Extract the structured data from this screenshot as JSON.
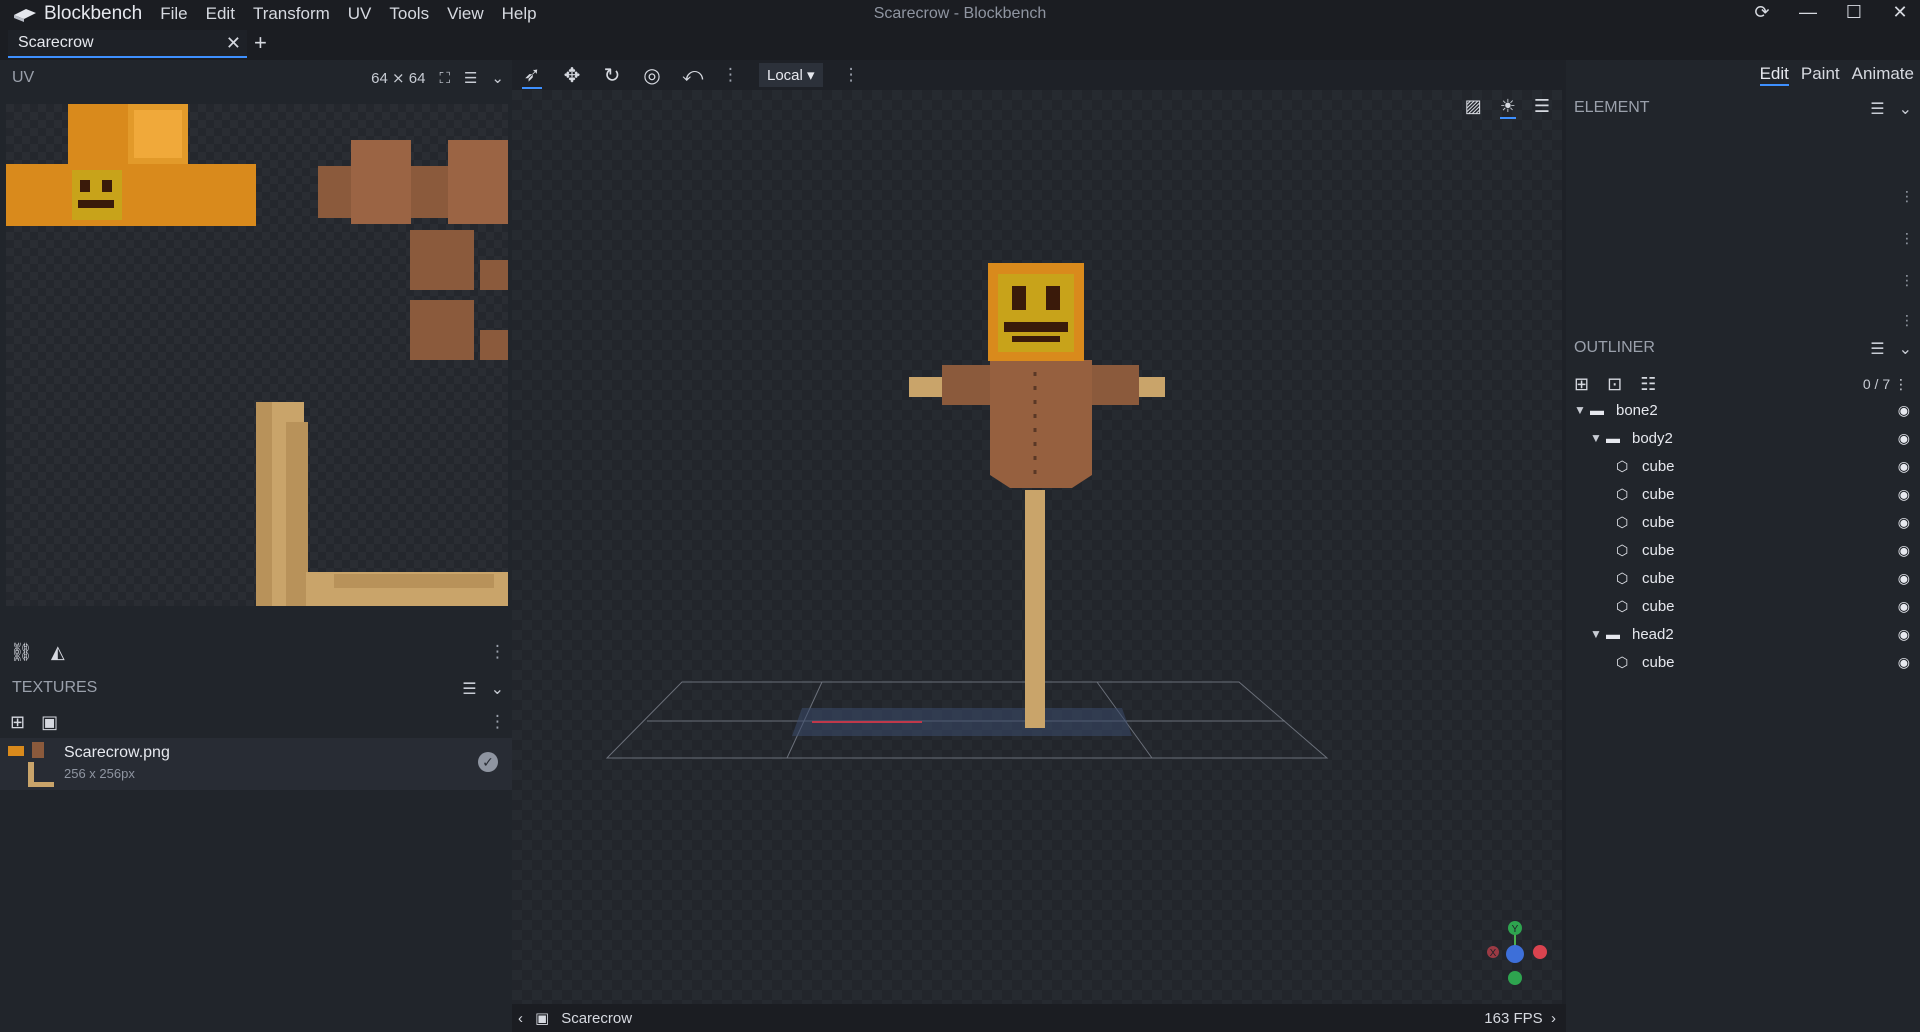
{
  "app": {
    "name": "Blockbench",
    "window_title": "Scarecrow - Blockbench",
    "menu": [
      "File",
      "Edit",
      "Transform",
      "UV",
      "Tools",
      "View",
      "Help"
    ]
  },
  "tabs": [
    {
      "label": "Scarecrow"
    }
  ],
  "left_panel": {
    "uv": {
      "title": "UV",
      "resolution": "64 ⨯ 64"
    },
    "textures": {
      "title": "TEXTURES",
      "items": [
        {
          "name": "Scarecrow.png",
          "size": "256 x 256px"
        }
      ]
    }
  },
  "toolbar": {
    "transform_space": "Local"
  },
  "viewport": {
    "status_name": "Scarecrow",
    "fps": "163 FPS"
  },
  "right_panel": {
    "modes": [
      "Edit",
      "Paint",
      "Animate"
    ],
    "active_mode": "Edit",
    "element_title": "ELEMENT",
    "outliner_title": "OUTLINER",
    "outliner_count": "0 / 7",
    "tree": [
      {
        "name": "bone2",
        "type": "group"
      },
      {
        "name": "body2",
        "type": "group"
      },
      {
        "name": "cube",
        "type": "cube"
      },
      {
        "name": "cube",
        "type": "cube"
      },
      {
        "name": "cube",
        "type": "cube"
      },
      {
        "name": "cube",
        "type": "cube"
      },
      {
        "name": "cube",
        "type": "cube"
      },
      {
        "name": "cube",
        "type": "cube"
      },
      {
        "name": "head2",
        "type": "group"
      },
      {
        "name": "cube",
        "type": "cube"
      }
    ]
  },
  "colors": {
    "accent": "#3e90ff",
    "panel": "#21252b",
    "viewport": "#262a30"
  }
}
